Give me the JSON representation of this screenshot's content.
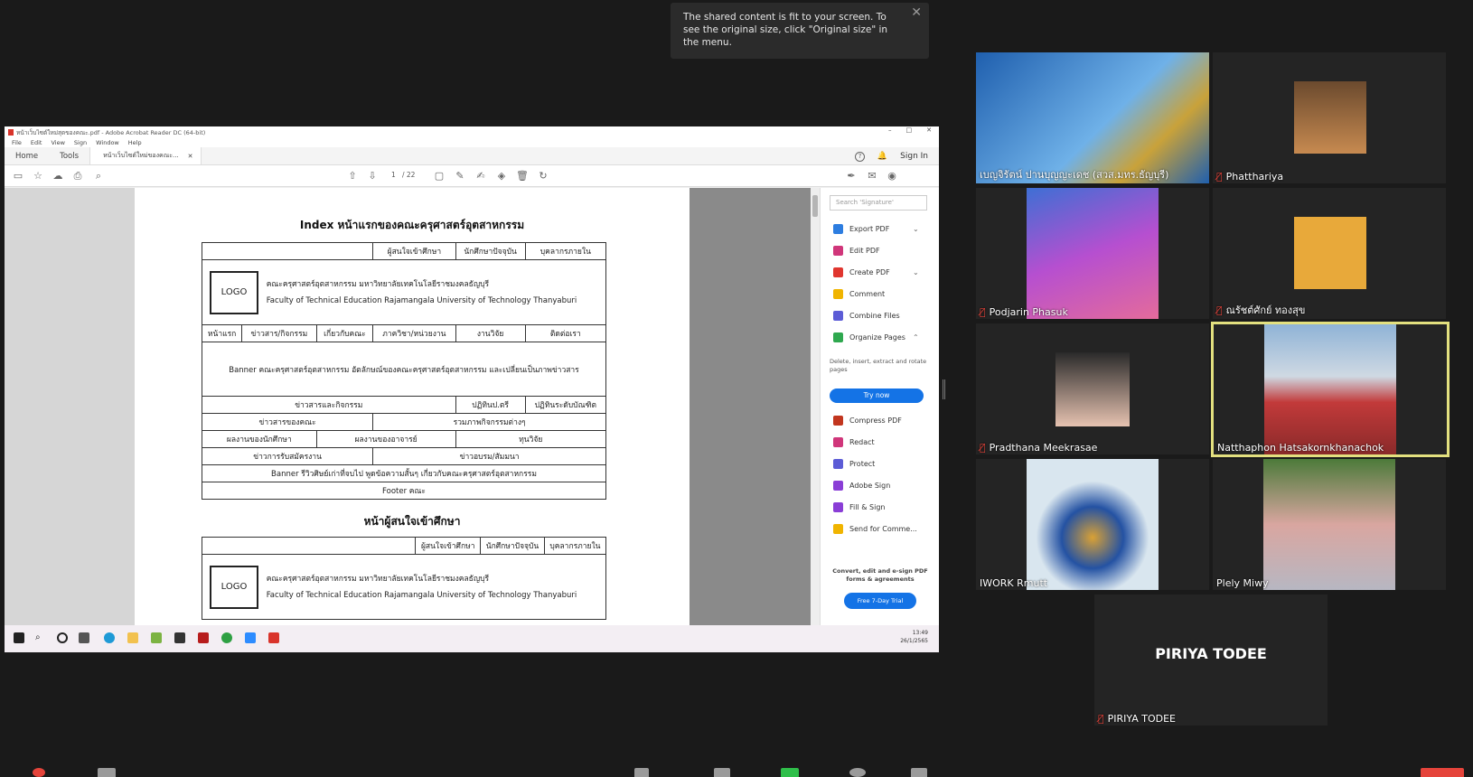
{
  "toast": {
    "text": "The shared content is fit to your screen. To see the original size, click \"Original size\" in the menu."
  },
  "acrobat": {
    "window_title": "หน้าเว็บไซต์ใหม่สุดของคณะ.pdf - Adobe Acrobat Reader DC (64-bit)",
    "menu": [
      "File",
      "Edit",
      "View",
      "Sign",
      "Window",
      "Help"
    ],
    "tabs": {
      "home": "Home",
      "tools": "Tools",
      "doc": "หน้าเว็บไซต์ใหม่ของคณะ..."
    },
    "sign_in": "Sign In",
    "page_current": "1",
    "page_total": "/ 22",
    "right_pane": {
      "search_placeholder": "Search 'Signature'",
      "tools": [
        {
          "label": "Export PDF",
          "color": "#2d7de0"
        },
        {
          "label": "Edit PDF",
          "color": "#d0367a"
        },
        {
          "label": "Create PDF",
          "color": "#e0362f"
        },
        {
          "label": "Comment",
          "color": "#f0b400"
        },
        {
          "label": "Combine Files",
          "color": "#5c5cd6"
        },
        {
          "label": "Organize Pages",
          "color": "#2fa84f"
        }
      ],
      "organize_desc": "Delete, insert, extract and rotate pages",
      "try_now": "Try now",
      "tools2": [
        {
          "label": "Compress PDF",
          "color": "#c2361f"
        },
        {
          "label": "Redact",
          "color": "#d0367a"
        },
        {
          "label": "Protect",
          "color": "#5c5cd6"
        },
        {
          "label": "Adobe Sign",
          "color": "#8a3ed6"
        },
        {
          "label": "Fill & Sign",
          "color": "#8a3ed6"
        },
        {
          "label": "Send for Comme...",
          "color": "#f0b400"
        }
      ],
      "promo": "Convert, edit and e-sign PDF forms & agreements",
      "trial": "Free 7-Day Trial"
    }
  },
  "document": {
    "heading1": "Index หน้าแรกของคณะครุศาสตร์อุตสาหกรรม",
    "heading2": "หน้าผู้สนใจเข้าศึกษา",
    "audiences": [
      "ผู้สนใจเข้าศึกษา",
      "นักศึกษาปัจจุบัน",
      "บุคลากรภายใน"
    ],
    "logo": "LOGO",
    "faculty_th": "คณะครุศาสตร์อุตสาหกรรม มหาวิทยาลัยเทคโนโลยีราชมงคลธัญบุรี",
    "faculty_en": "Faculty of Technical Education Rajamangala University of Technology Thanyaburi",
    "nav": [
      "หน้าแรก",
      "ข่าวสาร/กิจกรรม",
      "เกี่ยวกับคณะ",
      "ภาควิชา/หน่วยงาน",
      "งานวิจัย",
      "ติดต่อเรา"
    ],
    "banner": "Banner คณะครุศาสตร์อุตสาหกรรม อัตลักษณ์ของคณะครุศาสตร์อุตสาหกรรม และเปลี่ยนเป็นภาพข่าวสาร",
    "row_news": [
      "ข่าวสารและกิจกรรม",
      "ปฏิทินป.ตรี",
      "ปฏิทินระดับบัณฑิต"
    ],
    "row_faculty": [
      "ข่าวสารของคณะ",
      "รวมภาพกิจกรรมต่างๆ"
    ],
    "row_works": [
      "ผลงานของนักศึกษา",
      "ผลงานของอาจารย์",
      "ทุนวิจัย"
    ],
    "row_jobs": [
      "ข่าวการรับสมัครงาน",
      "ข่าวอบรม/สัมมนา"
    ],
    "review_banner": "Banner รีวิวศิษย์เก่าที่จบไป พูดข้อความสั้นๆ เกี่ยวกับคณะครุศาสตร์อุตสาหกรรม",
    "footer": "Footer คณะ"
  },
  "taskbar": {
    "time": "13:49",
    "date": "26/1/2565"
  },
  "participants": [
    {
      "name": "เบญจิรัตน์ ปานบุญญะเดช (สวส.มทร.ธัญบุรี)",
      "muted": false
    },
    {
      "name": "Phatthariya",
      "muted": true
    },
    {
      "name": "Podjarin Phasuk",
      "muted": true
    },
    {
      "name": "ณรัชต์ศักย์ ทองสุข",
      "muted": true
    },
    {
      "name": "Pradthana Meekrasae",
      "muted": true
    },
    {
      "name": "Natthaphon Hatsakornkhanachok",
      "muted": false
    },
    {
      "name": "IWORK Rmutt",
      "muted": false
    },
    {
      "name": "Plely Miwy",
      "muted": false
    },
    {
      "name": "PIRIYA TODEE",
      "muted": true
    }
  ],
  "avatar_text": "PIRIYA TODEE",
  "icons": {
    "mute": "muted-mic-icon",
    "close": "close-icon"
  }
}
